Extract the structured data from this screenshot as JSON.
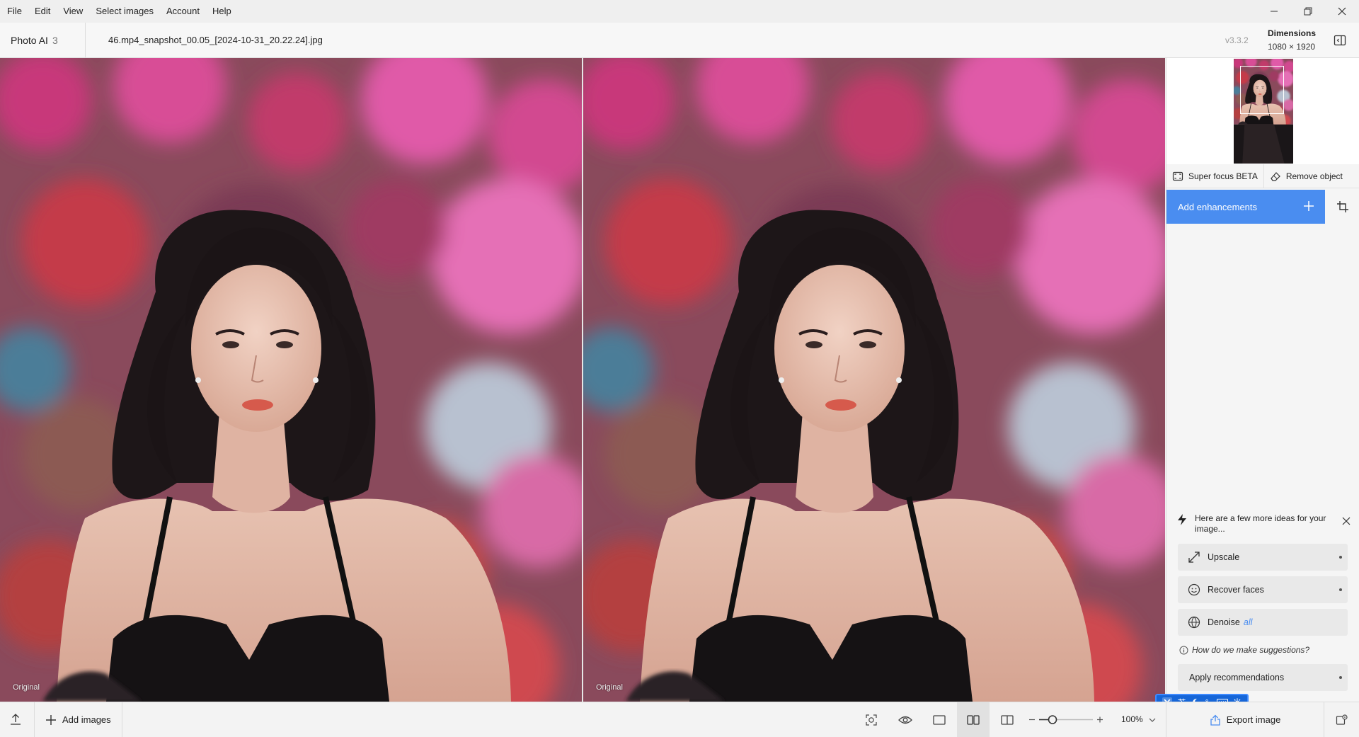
{
  "menu": [
    "File",
    "Edit",
    "View",
    "Select images",
    "Account",
    "Help"
  ],
  "header": {
    "app_name": "Photo AI",
    "app_major": "3",
    "filename": "46.mp4_snapshot_00.05_[2024-10-31_20.22.24].jpg",
    "version": "v3.3.2",
    "dimensions_label": "Dimensions",
    "dimensions_value": "1080 × 1920"
  },
  "viewer": {
    "left_label": "Original",
    "right_label": "Original"
  },
  "panel": {
    "super_focus": "Super focus BETA",
    "remove_object": "Remove object",
    "add_enhancements": "Add enhancements",
    "ideas_heading": "Here are a few more ideas for your image...",
    "suggestions": [
      {
        "label": "Upscale",
        "icon": "upscale-icon"
      },
      {
        "label": "Recover faces",
        "icon": "face-icon"
      },
      {
        "label": "Denoise",
        "icon": "denoise-icon",
        "tag": "all"
      }
    ],
    "how_link": "How do we make suggestions?",
    "apply_recommendations": "Apply recommendations"
  },
  "ime": [
    "英",
    "°,"
  ],
  "bottom": {
    "add_images": "Add images",
    "zoom": "100%",
    "zoom_level": 0.25,
    "export_image": "Export image"
  },
  "colors": {
    "accent": "#4a8df0",
    "ime_blue": "#1666d8"
  }
}
